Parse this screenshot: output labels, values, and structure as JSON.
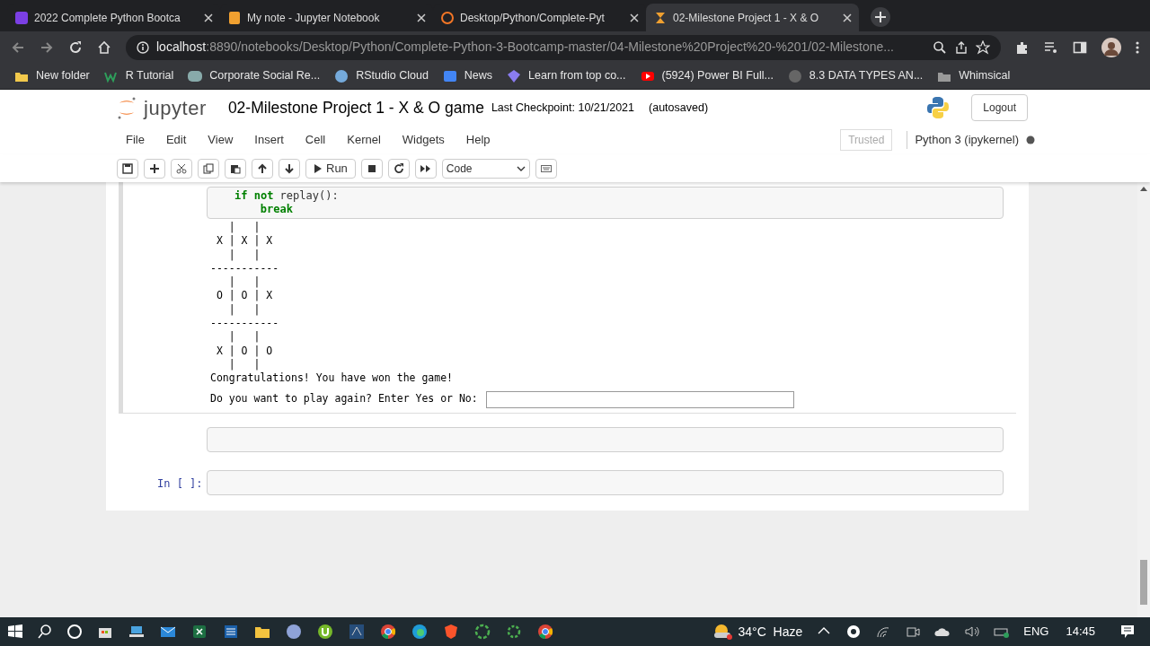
{
  "browser": {
    "tabs": [
      {
        "title": "2022 Complete Python Bootca",
        "selected": false
      },
      {
        "title": "My note - Jupyter Notebook",
        "selected": false
      },
      {
        "title": "Desktop/Python/Complete-Pyt",
        "selected": false
      },
      {
        "title": "02-Milestone Project 1 - X & O",
        "selected": true
      }
    ],
    "address": {
      "host": "localhost",
      "rest": ":8890/notebooks/Desktop/Python/Complete-Python-3-Bootcamp-master/04-Milestone%20Project%20-%201/02-Milestone..."
    },
    "bookmarks": [
      "New folder",
      "R Tutorial",
      "Corporate Social Re...",
      "RStudio Cloud",
      "News",
      "Learn from top co...",
      "(5924) Power BI Full...",
      "8.3 DATA TYPES AN...",
      "Whimsical"
    ]
  },
  "jupyter": {
    "logo": "jupyter",
    "notebook_title": "02-Milestone Project 1 - X & O game",
    "checkpoint": "Last Checkpoint: 10/21/2021",
    "autosave": "(autosaved)",
    "logout": "Logout",
    "menu": [
      "File",
      "Edit",
      "View",
      "Insert",
      "Cell",
      "Kernel",
      "Widgets",
      "Help"
    ],
    "trusted": "Trusted",
    "kernel": "Python 3 (ipykernel)",
    "toolbar": {
      "run": "Run",
      "cell_type": "Code"
    }
  },
  "cells": [
    {
      "kind": "code",
      "selected": true,
      "code": [
        {
          "tokens": [
            {
              "text": "if",
              "kind": "keyword"
            },
            {
              "text": " not",
              "kind": "keyword"
            },
            {
              "text": " replay():",
              "kind": "plain"
            }
          ],
          "children": [
            {
              "tokens": [
                {
                  "text": "break",
                  "kind": "keyword"
                }
              ]
            }
          ]
        }
      ],
      "output": [
        "   |   |",
        " X | X | X",
        "   |   |",
        "-----------",
        "   |   |",
        " O | O | X",
        "   |   |",
        "-----------",
        "   |   |",
        " X | O | O",
        "   |   |",
        "Congratulations! You have won the game!"
      ],
      "prompt": {
        "text": "Do you want to play again? Enter Yes or No:"
      }
    },
    {
      "kind": "code",
      "selected": false
    },
    {
      "kind": "code",
      "selected": false,
      "label": "In [ ]:"
    }
  ],
  "taskbar": {
    "weather": "34°C  Haze",
    "language": "ENG",
    "time": "14:45"
  }
}
